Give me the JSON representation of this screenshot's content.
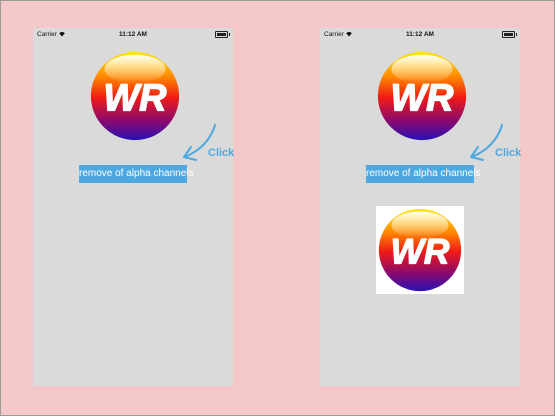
{
  "status_bar": {
    "carrier": "Carrier",
    "time": "11:12 AM",
    "battery_level_percent": 100
  },
  "logo_text": "WR",
  "button_label": "remove of alpha channels",
  "hint_label": "Click",
  "colors": {
    "background": "#f4c8c8",
    "screen": "#dadada",
    "button": "#4ea8e0",
    "hint": "#4ea8e0",
    "logo_gradient": [
      "#ffe600",
      "#ff8a00",
      "#f01a16",
      "#8a0a6e",
      "#2a0fb4"
    ]
  },
  "icons": [
    "wifi-icon",
    "battery-icon",
    "arrow-icon"
  ],
  "panels": [
    {
      "id": "before",
      "result_image_shown": false
    },
    {
      "id": "after",
      "result_image_shown": true
    }
  ]
}
